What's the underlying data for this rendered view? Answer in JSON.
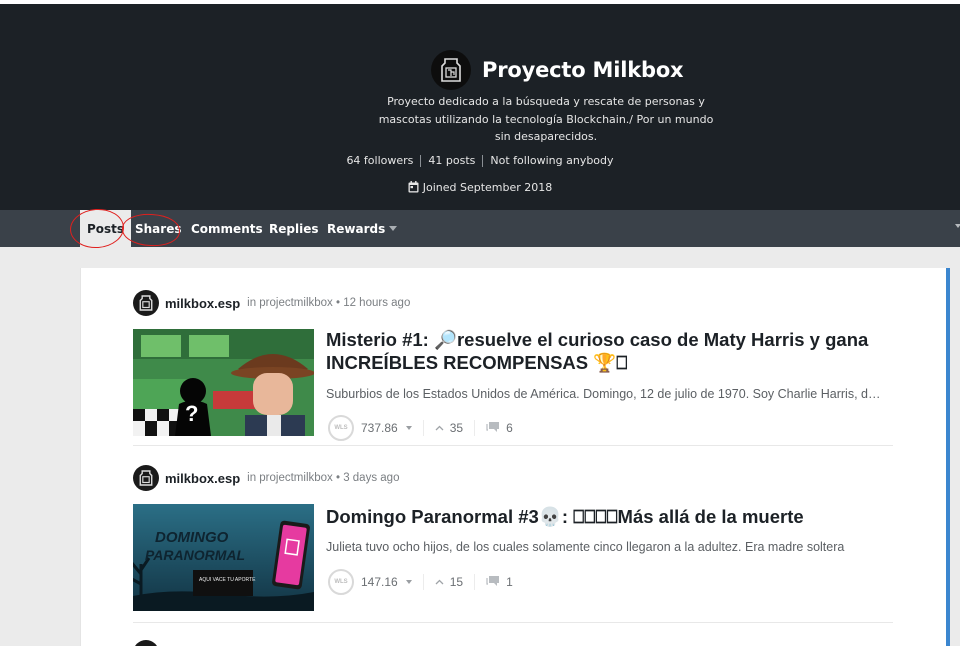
{
  "profile": {
    "title": "Proyecto Milkbox",
    "about": "Proyecto dedicado a la búsqueda y rescate de personas y mascotas utilizando la tecnología Blockchain./ Por un mundo sin desaparecidos.",
    "followers": "64 followers",
    "posts": "41 posts",
    "following": "Not following anybody",
    "joined": "Joined September 2018"
  },
  "tabs": {
    "posts": "Posts",
    "shares": "Shares",
    "comments": "Comments",
    "replies": "Replies",
    "rewards": "Rewards"
  },
  "feed": [
    {
      "author": "milkbox.esp",
      "meta": "in projectmilkbox • 12 hours ago",
      "title": "Misterio #1: 🔎resuelve el curioso caso de Maty Harris y gana INCREÍBLES RECOMPENSAS 🏆⎕",
      "excerpt": "Suburbios de los Estados Unidos de América. Domingo, 12 de julio de 1970. Soy Charlie Harris, detective privado",
      "wls_label": "WLS",
      "payout": "737.86",
      "votes": "35",
      "comments": "6"
    },
    {
      "author": "milkbox.esp",
      "meta": "in projectmilkbox • 3 days ago",
      "title": "Domingo Paranormal #3💀: ⎕⎕⎕⎕Más allá de la muerte",
      "excerpt": "Julieta tuvo ocho hijos, de los cuales solamente cinco llegaron a la adultez. Era madre soltera",
      "wls_label": "WLS",
      "payout": "147.16",
      "votes": "15",
      "comments": "1"
    }
  ],
  "thumb2": {
    "line1": "DOMINGO",
    "line2": "PARANORMAL",
    "banner": "AQUI VACE TU APORTE"
  }
}
